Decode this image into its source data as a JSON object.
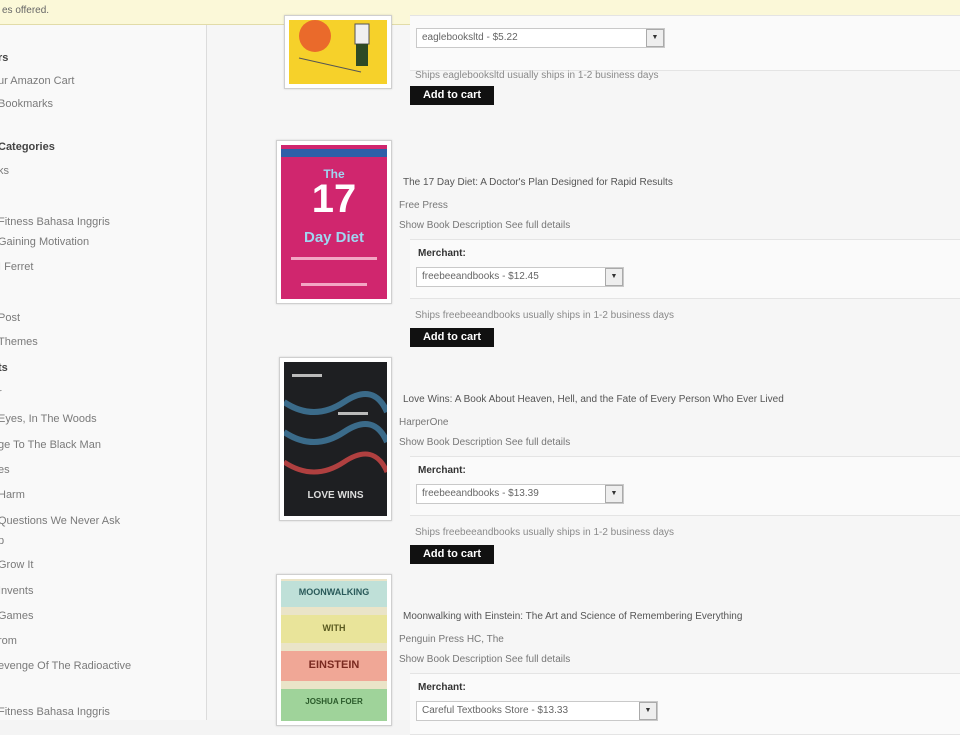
{
  "topbar": {
    "text": "es offered."
  },
  "sidebar": {
    "items": [
      {
        "label": "rs",
        "bold": true
      },
      {
        "label": "ur Amazon Cart",
        "bold": false
      },
      {
        "label": "Bookmarks",
        "bold": false
      },
      {
        "label": "Categories",
        "bold": true
      },
      {
        "label": "ks",
        "bold": false
      },
      {
        "label": "Fitness Bahasa Inggris",
        "bold": false
      },
      {
        "label": "Gaining Motivation",
        "bold": false
      },
      {
        "label": "I Ferret",
        "bold": false
      },
      {
        "label": "Post",
        "bold": false
      },
      {
        "label": "Themes",
        "bold": false
      },
      {
        "label": "ts",
        "bold": true
      },
      {
        "label": "r",
        "bold": false
      },
      {
        "label": "Eyes, In The Woods",
        "bold": false
      },
      {
        "label": "ge To The Black Man",
        "bold": false
      },
      {
        "label": "es",
        "bold": false
      },
      {
        "label": "Harm",
        "bold": false
      },
      {
        "label": "Questions We Never Ask",
        "bold": false
      },
      {
        "label": "p",
        "bold": false
      },
      {
        "label": "Grow It",
        "bold": false
      },
      {
        "label": "Invents",
        "bold": false
      },
      {
        "label": "Games",
        "bold": false
      },
      {
        "label": "rom",
        "bold": false
      },
      {
        "label": "evenge Of The Radioactive",
        "bold": false
      },
      {
        "label": "Fitness Bahasa Inggris",
        "bold": false
      }
    ]
  },
  "products": [
    {
      "title": "",
      "publisher": "",
      "description": "",
      "merchant_label": "",
      "merchant_value": "eaglebooksltd - $5.22",
      "shipping": "Ships eaglebooksltd usually ships in 1-2 business days",
      "cart_label": "Add to cart",
      "cover": {
        "title": "",
        "color": "#f6d12a"
      }
    },
    {
      "title": "The 17 Day Diet: A Doctor's Plan Designed for Rapid Results",
      "publisher": "Free Press",
      "description": "Show Book Description  See full details",
      "merchant_label": "Merchant:",
      "merchant_value": "freebeeandbooks - $12.45",
      "shipping": "Ships freebeeandbooks usually ships in 1-2 business days",
      "cart_label": "Add to cart",
      "cover": {
        "title": "17",
        "subtitle": "Day Diet",
        "color": "#d0266e"
      }
    },
    {
      "title": "Love Wins: A Book About Heaven, Hell, and the Fate of Every Person Who Ever Lived",
      "publisher": "HarperOne",
      "description": "Show Book Description  See full details",
      "merchant_label": "Merchant:",
      "merchant_value": "freebeeandbooks - $13.39",
      "shipping": "Ships freebeeandbooks usually ships in 1-2 business days",
      "cart_label": "Add to cart",
      "cover": {
        "title": "LOVE WINS",
        "color": "#1e1f22"
      }
    },
    {
      "title": "Moonwalking with Einstein: The Art and Science of Remembering Everything",
      "publisher": "Penguin Press HC, The",
      "description": "Show Book Description  See full details",
      "merchant_label": "Merchant:",
      "merchant_value": "Careful Textbooks Store - $13.33",
      "shipping": "",
      "cart_label": "",
      "cover": {
        "lines": [
          "MOONWALKING",
          "WITH",
          "EINSTEIN",
          "JOSHUA FOER"
        ],
        "color": "#eae4c8"
      }
    }
  ]
}
